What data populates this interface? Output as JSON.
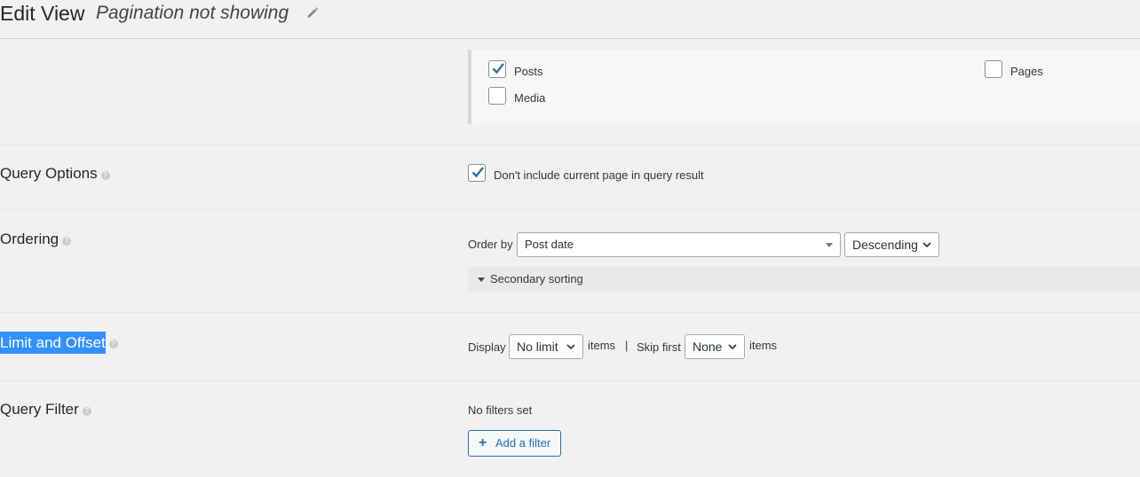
{
  "header": {
    "title": "Edit View",
    "view_name": "Pagination not showing",
    "edit_icon": "pencil-icon"
  },
  "post_types": {
    "items": [
      {
        "label": "Posts",
        "checked": true
      },
      {
        "label": "Pages",
        "checked": false
      },
      {
        "label": "Media",
        "checked": false
      }
    ]
  },
  "sections": {
    "query_options": "Query Options",
    "ordering": "Ordering",
    "limit_offset": "Limit and Offset",
    "query_filter": "Query Filter"
  },
  "query_options": {
    "exclude_current_label": "Don't include current page in query result",
    "exclude_current_checked": true
  },
  "ordering": {
    "order_by_label": "Order by",
    "order_by_value": "Post date",
    "direction_value": "Descending",
    "secondary_sorting_label": "Secondary sorting"
  },
  "limit": {
    "display_label": "Display",
    "limit_value": "No limit",
    "items_label": "items",
    "separator": "|",
    "skip_label": "Skip first",
    "skip_value": "None",
    "items_label_2": "items"
  },
  "filter": {
    "no_filters_text": "No filters set",
    "add_filter_label": "Add a filter"
  },
  "colors": {
    "accent": "#2271b1",
    "highlight": "#3390ff"
  }
}
